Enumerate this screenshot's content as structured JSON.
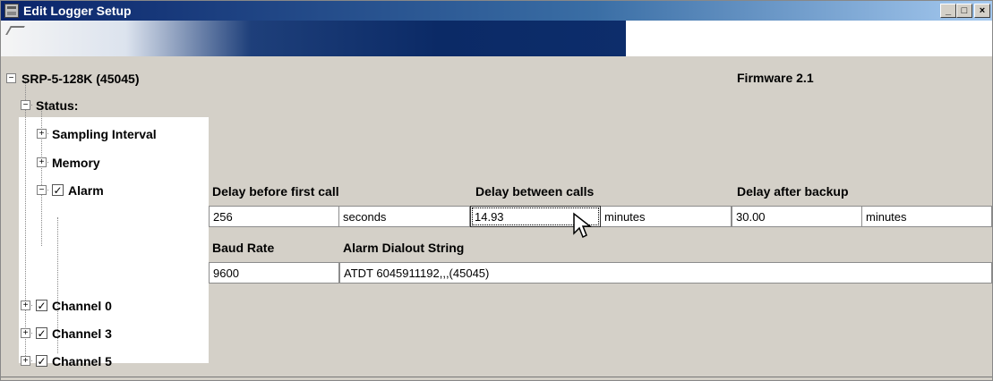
{
  "window": {
    "title": "Edit Logger Setup",
    "minimize": "_",
    "maximize": "□",
    "close": "×"
  },
  "device": {
    "name": "SRP-5-128K (45045)",
    "firmware": "Firmware 2.1"
  },
  "tree": {
    "status_label": "Status:",
    "sampling_label": "Sampling Interval",
    "memory_label": "Memory",
    "alarm_label": "Alarm",
    "channels": [
      "Channel 0",
      "Channel 3",
      "Channel 5"
    ]
  },
  "alarm": {
    "delay_first_label": "Delay before first call",
    "delay_first_value": "256",
    "delay_first_unit": "seconds",
    "delay_between_label": "Delay between calls",
    "delay_between_value": "14.93",
    "delay_between_unit": "minutes",
    "delay_backup_label": "Delay after backup",
    "delay_backup_value": "30.00",
    "delay_backup_unit": "minutes",
    "baud_label": "Baud Rate",
    "baud_value": "9600",
    "dialout_label": "Alarm Dialout String",
    "dialout_value": "ATDT 6045911192,,,(45045)"
  },
  "glyphs": {
    "expanded": "−",
    "collapsed": "+",
    "checked": "✓"
  },
  "colors": {
    "title_bar": "#0a246a",
    "panel_bg": "#d4d0c8",
    "cell_bg": "#ffffff"
  }
}
